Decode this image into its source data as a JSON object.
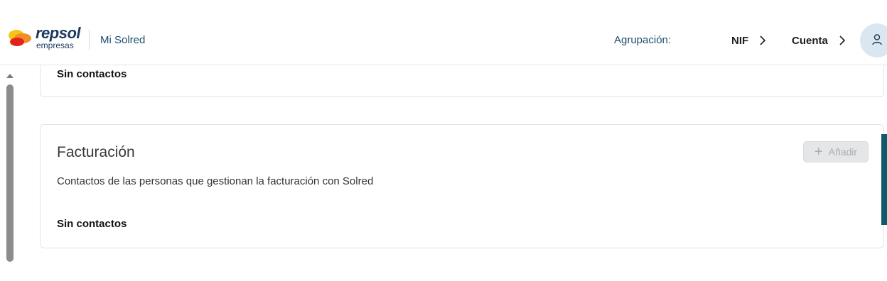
{
  "header": {
    "brand_name": "repsol",
    "brand_sub": "empresas",
    "app_name": "Mi Solred",
    "group_label": "Agrupación:",
    "nav": [
      {
        "label": "NIF"
      },
      {
        "label": "Cuenta"
      }
    ]
  },
  "cards": {
    "previous": {
      "empty_text": "Sin contactos"
    },
    "billing": {
      "title": "Facturación",
      "description": "Contactos de las personas que gestionan la facturación con Solred",
      "add_label": "Añadir",
      "empty_text": "Sin contactos"
    }
  },
  "colors": {
    "brand_dark": "#1b3a5c",
    "logo_orange": "#f28c28",
    "logo_yellow": "#f5c518",
    "logo_red": "#e2231a",
    "accent": "#0e5a6a",
    "avatar_bg": "#dbe7f0"
  },
  "icons": [
    "repsol-logo-icon",
    "chevron-right-icon",
    "user-icon",
    "plus-icon",
    "scroll-up-arrow-icon"
  ]
}
